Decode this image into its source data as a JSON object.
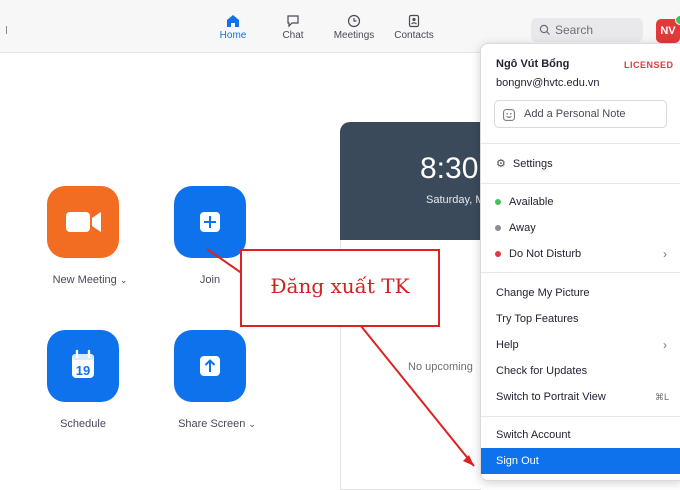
{
  "nav": {
    "items": [
      {
        "label": "Home",
        "icon": "home-icon"
      },
      {
        "label": "Chat",
        "icon": "chat-icon"
      },
      {
        "label": "Meetings",
        "icon": "clock-icon"
      },
      {
        "label": "Contacts",
        "icon": "contacts-icon"
      }
    ],
    "active": "Home"
  },
  "search": {
    "placeholder": "Search"
  },
  "avatar": {
    "initials": "NV",
    "color": "#e03a3a"
  },
  "home_actions": {
    "new_meeting": "New Meeting",
    "join": "Join",
    "schedule": "Schedule",
    "schedule_day": "19",
    "share_screen": "Share Screen"
  },
  "clock": {
    "time": "8:30",
    "date": "Saturday, M"
  },
  "center": {
    "no_upcoming": "No upcoming"
  },
  "menu": {
    "user_name": "Ngô Vút Bổng",
    "license": "LICENSED",
    "email": "bongnv@hvtc.edu.vn",
    "note_placeholder": "Add a Personal Note",
    "settings": "Settings",
    "statuses": [
      {
        "label": "Available",
        "color": "#3cc45a"
      },
      {
        "label": "Away",
        "color": "#8c8c96"
      },
      {
        "label": "Do Not Disturb",
        "color": "#e03a3a"
      }
    ],
    "items": [
      "Change My Picture",
      "Try Top Features",
      "Help",
      "Check for Updates",
      "Switch to Portrait View"
    ],
    "portrait_shortcut": "⌘L",
    "switch_account": "Switch Account",
    "sign_out": "Sign Out"
  },
  "annotation": {
    "text": "Đăng xuất TK",
    "color": "#e02020"
  },
  "colors": {
    "accent": "#0e72ed",
    "new_meeting": "#f26d21"
  }
}
